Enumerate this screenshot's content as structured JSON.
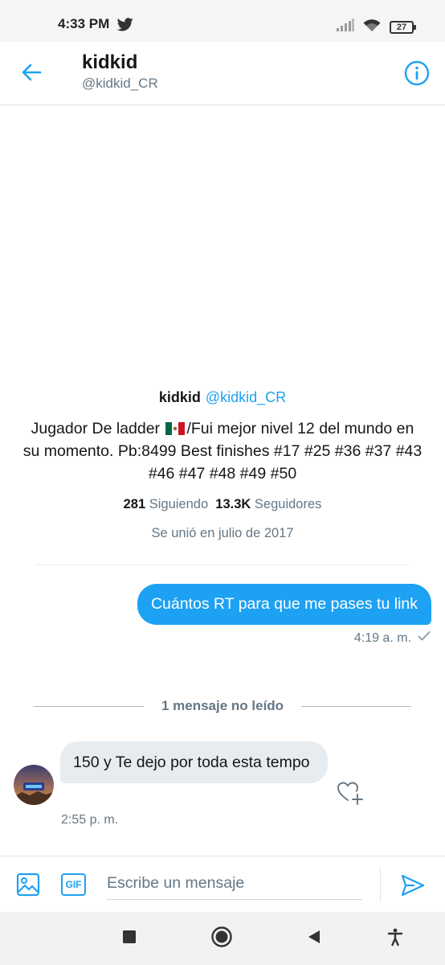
{
  "status_bar": {
    "time": "4:33 PM",
    "battery": "27",
    "icons": [
      "twitter-icon",
      "signal-icon",
      "wifi-icon",
      "battery-icon"
    ]
  },
  "header": {
    "name": "kidkid",
    "handle": "@kidkid_CR",
    "icons": [
      "back-arrow-icon",
      "info-icon"
    ]
  },
  "profile": {
    "name": "kidkid",
    "handle": "@kidkid_CR",
    "bio_before_flag": "Jugador De ladder",
    "bio_after_flag": "/Fui mejor nivel 12 del mundo en su momento. Pb:8499 Best finishes #17 #25 #36 #37 #43 #46 #47 #48 #49 #50",
    "following_count": "281",
    "following_label": "Siguiendo",
    "followers_count": "13.3K",
    "followers_label": "Seguidores",
    "joined": "Se unió en julio de 2017"
  },
  "messages": {
    "sent": {
      "text": "Cuántos RT para que me pases tu link",
      "time": "4:19 a. m."
    },
    "unread_divider": "1 mensaje no leído",
    "received": {
      "text": "150 y Te dejo por toda esta tempo",
      "time": "2:55 p. m."
    }
  },
  "composer": {
    "gif_label": "GIF",
    "placeholder": "Escribe un mensaje",
    "icons": [
      "image-icon",
      "gif-icon",
      "send-icon"
    ]
  },
  "navigation": {
    "icons": [
      "recents-square-icon",
      "home-circle-icon",
      "back-triangle-icon",
      "accessibility-icon"
    ]
  },
  "colors": {
    "accent": "#1da1f2",
    "received_bubble": "#e6ecf0",
    "secondary_text": "#657786",
    "primary_text": "#14171a"
  }
}
